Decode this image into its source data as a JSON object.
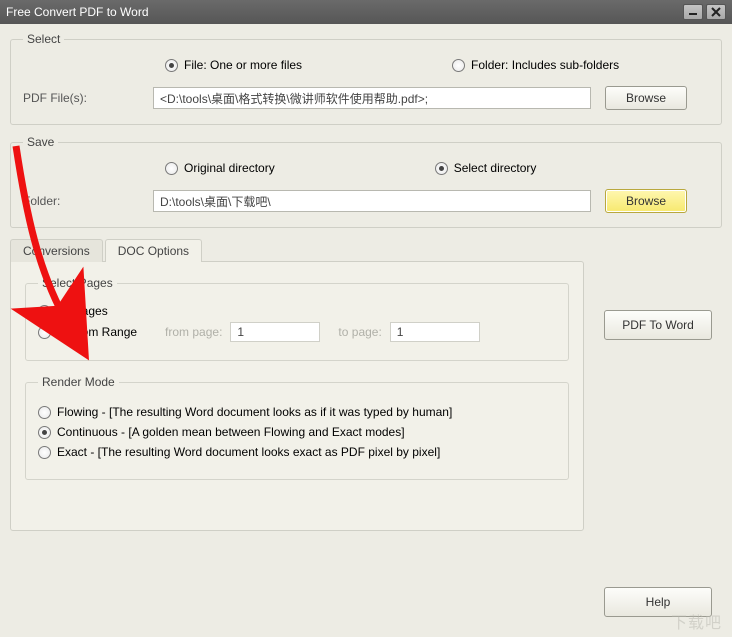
{
  "window": {
    "title": "Free Convert PDF to Word"
  },
  "select": {
    "legend": "Select",
    "file_radio": "File:  One or more files",
    "folder_radio": "Folder: Includes sub-folders",
    "files_label": "PDF File(s):",
    "files_value": "<D:\\tools\\桌面\\格式转换\\微讲师软件使用帮助.pdf>;",
    "browse": "Browse"
  },
  "save": {
    "legend": "Save",
    "original_radio": "Original directory",
    "select_radio": "Select directory",
    "folder_label": "Folder:",
    "folder_value": "D:\\tools\\桌面\\下载吧\\",
    "browse": "Browse"
  },
  "tabs": {
    "conversions": "Conversions",
    "doc_options": "DOC Options"
  },
  "pages": {
    "legend": "Select Pages",
    "all": "All Pages",
    "custom": "Custom Range",
    "from_label": "from page:",
    "from_value": "1",
    "to_label": "to page:",
    "to_value": "1"
  },
  "render": {
    "legend": "Render Mode",
    "flowing": "Flowing - [The resulting Word document looks as if it was typed by human]",
    "continuous": "Continuous - [A golden mean between Flowing and Exact modes]",
    "exact": "Exact - [The resulting Word document looks exact as PDF pixel by pixel]"
  },
  "actions": {
    "pdf_to_word": "PDF To Word",
    "help": "Help"
  },
  "watermark": "下载吧"
}
